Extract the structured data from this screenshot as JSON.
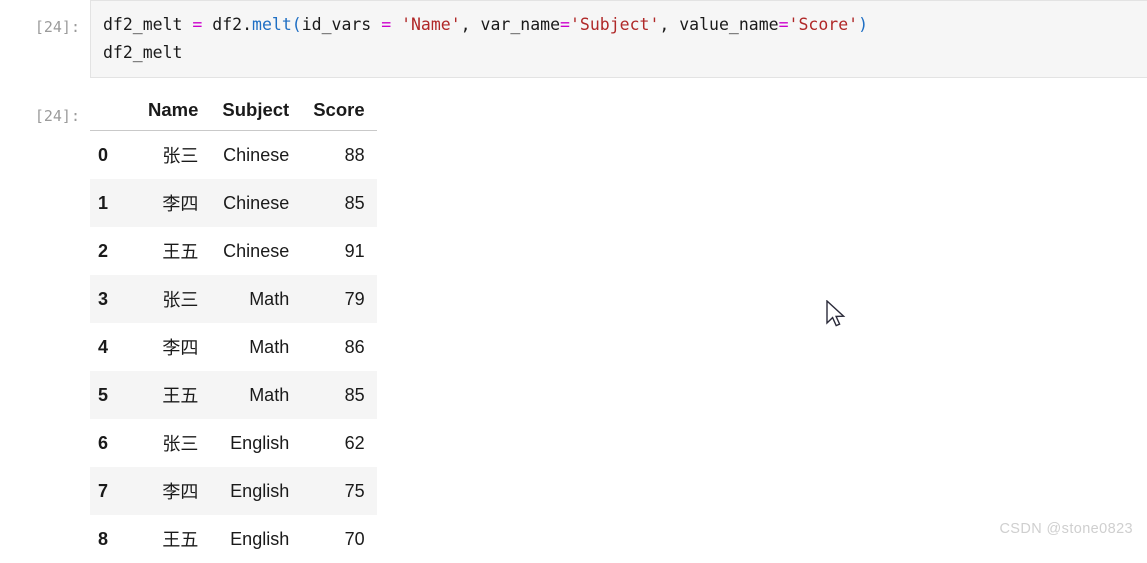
{
  "input_cell": {
    "prompt": "[24]:",
    "code_lines": [
      [
        {
          "t": "df2_melt ",
          "c": "plain"
        },
        {
          "t": "=",
          "c": "op"
        },
        {
          "t": " df2.",
          "c": "plain"
        },
        {
          "t": "melt",
          "c": "fn"
        },
        {
          "t": "(",
          "c": "paren"
        },
        {
          "t": "id_vars ",
          "c": "plain"
        },
        {
          "t": "=",
          "c": "op"
        },
        {
          "t": " ",
          "c": "plain"
        },
        {
          "t": "'Name'",
          "c": "str"
        },
        {
          "t": ", ",
          "c": "punct"
        },
        {
          "t": "var_name",
          "c": "plain"
        },
        {
          "t": "=",
          "c": "op"
        },
        {
          "t": "'Subject'",
          "c": "str"
        },
        {
          "t": ", ",
          "c": "punct"
        },
        {
          "t": "value_name",
          "c": "plain"
        },
        {
          "t": "=",
          "c": "op"
        },
        {
          "t": "'Score'",
          "c": "str"
        },
        {
          "t": ")",
          "c": "paren"
        }
      ],
      [
        {
          "t": "df2_melt",
          "c": "plain"
        }
      ]
    ]
  },
  "output_cell": {
    "prompt": "[24]:",
    "table": {
      "index_header": "",
      "columns": [
        "Name",
        "Subject",
        "Score"
      ],
      "index": [
        "0",
        "1",
        "2",
        "3",
        "4",
        "5",
        "6",
        "7",
        "8"
      ],
      "rows": [
        [
          "张三",
          "Chinese",
          "88"
        ],
        [
          "李四",
          "Chinese",
          "85"
        ],
        [
          "王五",
          "Chinese",
          "91"
        ],
        [
          "张三",
          "Math",
          "79"
        ],
        [
          "李四",
          "Math",
          "86"
        ],
        [
          "王五",
          "Math",
          "85"
        ],
        [
          "张三",
          "English",
          "62"
        ],
        [
          "李四",
          "English",
          "75"
        ],
        [
          "王五",
          "English",
          "70"
        ]
      ]
    }
  },
  "watermark": "CSDN @stone0823",
  "colors": {
    "code_background": "#f6f6f6",
    "string_token": "#b02828",
    "operator_token": "#cc00cc",
    "function_token": "#1f6fc4",
    "prompt_text": "#9b9b9b",
    "stripe_row": "#f5f5f5",
    "watermark": "#cfcfcf"
  }
}
